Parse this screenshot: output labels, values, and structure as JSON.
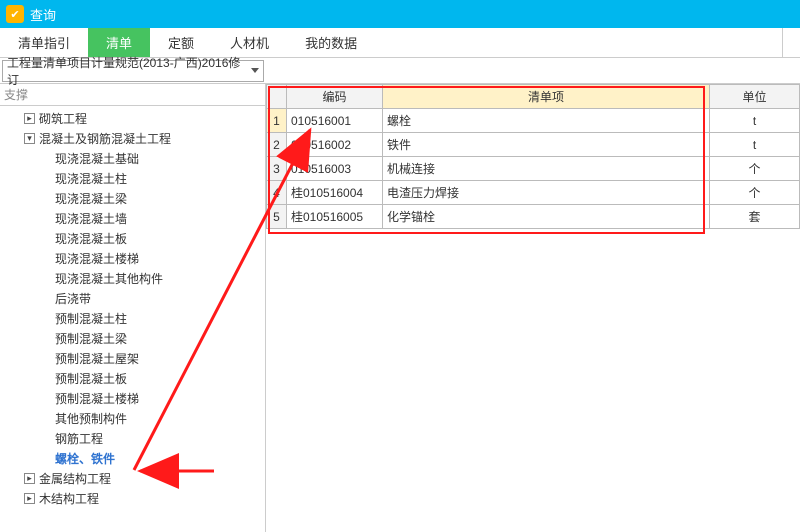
{
  "window": {
    "title": "查询",
    "icon_glyph": "✔"
  },
  "tabs": {
    "items": [
      {
        "label": "清单指引"
      },
      {
        "label": "清单"
      },
      {
        "label": "定额"
      },
      {
        "label": "人材机"
      },
      {
        "label": "我的数据"
      }
    ],
    "active_index": 1
  },
  "dropdown": {
    "value": "工程量清单项目计量规范(2013-广西)2016修订"
  },
  "filter": {
    "placeholder": "支撑"
  },
  "tree": [
    {
      "level": 1,
      "expand": "closed",
      "label": "砌筑工程"
    },
    {
      "level": 1,
      "expand": "open",
      "label": "混凝土及钢筋混凝土工程"
    },
    {
      "level": 2,
      "label": "现浇混凝土基础"
    },
    {
      "level": 2,
      "label": "现浇混凝土柱"
    },
    {
      "level": 2,
      "label": "现浇混凝土梁"
    },
    {
      "level": 2,
      "label": "现浇混凝土墙"
    },
    {
      "level": 2,
      "label": "现浇混凝土板"
    },
    {
      "level": 2,
      "label": "现浇混凝土楼梯"
    },
    {
      "level": 2,
      "label": "现浇混凝土其他构件"
    },
    {
      "level": 2,
      "label": "后浇带"
    },
    {
      "level": 2,
      "label": "预制混凝土柱"
    },
    {
      "level": 2,
      "label": "预制混凝土梁"
    },
    {
      "level": 2,
      "label": "预制混凝土屋架"
    },
    {
      "level": 2,
      "label": "预制混凝土板"
    },
    {
      "level": 2,
      "label": "预制混凝土楼梯"
    },
    {
      "level": 2,
      "label": "其他预制构件"
    },
    {
      "level": 2,
      "label": "钢筋工程"
    },
    {
      "level": 2,
      "label": "螺栓、铁件",
      "selected": true
    },
    {
      "level": 1,
      "expand": "closed",
      "label": "金属结构工程"
    },
    {
      "level": 1,
      "expand": "closed",
      "label": "木结构工程"
    }
  ],
  "grid": {
    "headers": {
      "code": "编码",
      "item": "清单项",
      "unit": "单位"
    },
    "rows": [
      {
        "n": "1",
        "code": "010516001",
        "item": "螺栓",
        "unit": "t",
        "sel": true
      },
      {
        "n": "2",
        "code": "010516002",
        "item": "铁件",
        "unit": "t"
      },
      {
        "n": "3",
        "code": "010516003",
        "item": "机械连接",
        "unit": "个"
      },
      {
        "n": "4",
        "code": "桂010516004",
        "item": "电渣压力焊接",
        "unit": "个"
      },
      {
        "n": "5",
        "code": "桂010516005",
        "item": "化学锚栓",
        "unit": "套"
      }
    ]
  }
}
